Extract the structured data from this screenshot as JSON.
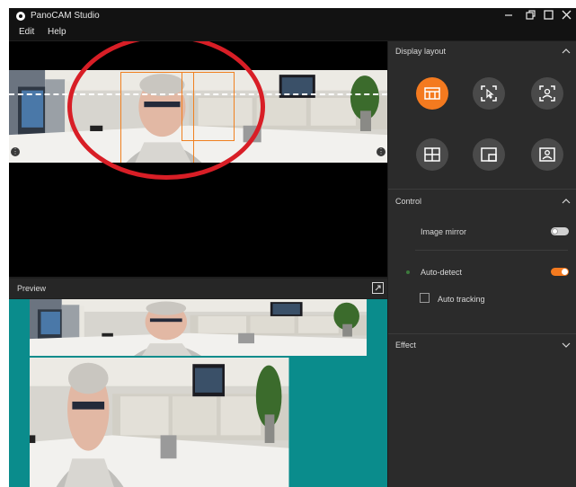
{
  "app": {
    "title": "PanoCAM Studio"
  },
  "window_controls": [
    "minimize-icon",
    "restore-icon",
    "maximize-icon",
    "close-icon"
  ],
  "menu": {
    "items": [
      "Edit",
      "Help"
    ]
  },
  "preview": {
    "label": "Preview"
  },
  "panel": {
    "display_layout": {
      "title": "Display layout",
      "buttons": [
        {
          "icon": "panorama-layout-icon",
          "active": true
        },
        {
          "icon": "manual-select-icon",
          "active": false
        },
        {
          "icon": "speaker-focus-icon",
          "active": false
        },
        {
          "icon": "grid-layout-icon",
          "active": false
        },
        {
          "icon": "picture-in-picture-icon",
          "active": false
        },
        {
          "icon": "presenter-icon",
          "active": false
        }
      ]
    },
    "control": {
      "title": "Control",
      "image_mirror": {
        "label": "Image mirror",
        "on": false
      },
      "auto_detect": {
        "label": "Auto-detect",
        "on": true
      },
      "auto_tracking": {
        "label": "Auto tracking",
        "checked": false
      }
    },
    "effect": {
      "title": "Effect"
    }
  },
  "colors": {
    "accent": "#f47a1f",
    "annotation": "#d81e26",
    "preview_bg": "#0a8c8c",
    "panel_bg": "#2b2b2b"
  }
}
